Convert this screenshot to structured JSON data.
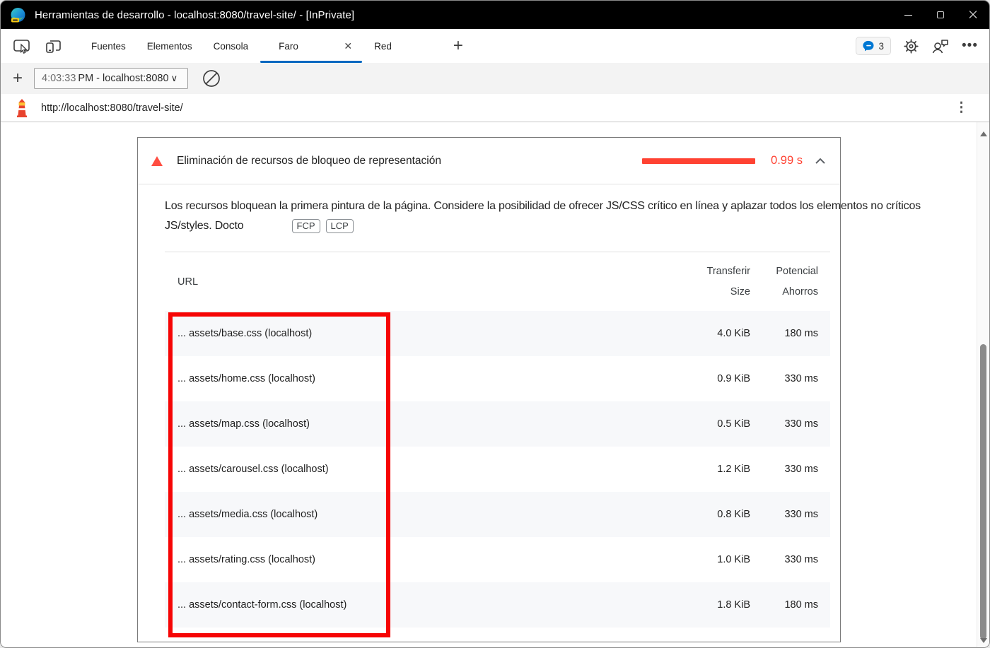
{
  "window": {
    "title": "Herramientas de desarrollo - localhost:8080/travel-site/ - [InPrivate]"
  },
  "tabs": {
    "items": [
      "Fuentes",
      "Elementos",
      "Consola",
      "Faro",
      "Red"
    ],
    "active": "Faro",
    "close_glyph": "✕",
    "new_tab_glyph": "+"
  },
  "header_right": {
    "badge_count": "3"
  },
  "runbar": {
    "add_glyph": "+",
    "session": {
      "time": "4:03:33",
      "label": "PM - localhost:8080"
    },
    "caret_glyph": "∨"
  },
  "urlbar": {
    "url": "http://localhost:8080/travel-site/",
    "more_glyph": "⋮"
  },
  "audit": {
    "title": "Eliminación de recursos de bloqueo de representación",
    "savings_value": "0.99 s",
    "description_line1": "Los recursos bloquean la primera pintura de la página. Considere la posibilidad de ofrecer JS/CSS crítico en línea y aplazar todos los elementos no críticos",
    "description_line2": "JS/styles. Docto",
    "chips": [
      "FCP",
      "LCP"
    ],
    "table": {
      "columns": {
        "url": "URL",
        "size_line1": "Transferir",
        "size_line2": "Size",
        "savings_line1": "Potencial",
        "savings_line2": "Ahorros"
      },
      "rows": [
        {
          "url": "... assets/base.css (localhost)",
          "size": "4.0 KiB",
          "savings": "180 ms"
        },
        {
          "url": "... assets/home.css (localhost)",
          "size": "0.9 KiB",
          "savings": "330 ms"
        },
        {
          "url": "... assets/map.css (localhost)",
          "size": "0.5 KiB",
          "savings": "330 ms"
        },
        {
          "url": "... assets/carousel.css (localhost)",
          "size": "1.2 KiB",
          "savings": "330 ms"
        },
        {
          "url": "... assets/media.css (localhost)",
          "size": "0.8 KiB",
          "savings": "330 ms"
        },
        {
          "url": "... assets/rating.css (localhost)",
          "size": "1.0 KiB",
          "savings": "330 ms"
        },
        {
          "url": "... assets/contact-form.css (localhost)",
          "size": "1.8 KiB",
          "savings": "180 ms"
        }
      ]
    }
  },
  "colors": {
    "accent_blue": "#0067c0",
    "audit_red": "#ff4232",
    "warning_red": "#ff4e42",
    "highlight_red": "#f60505",
    "titlebar_black": "#000000",
    "toolbar_gray": "#f3f3f3",
    "zebra_row": "#f7f8fa"
  }
}
